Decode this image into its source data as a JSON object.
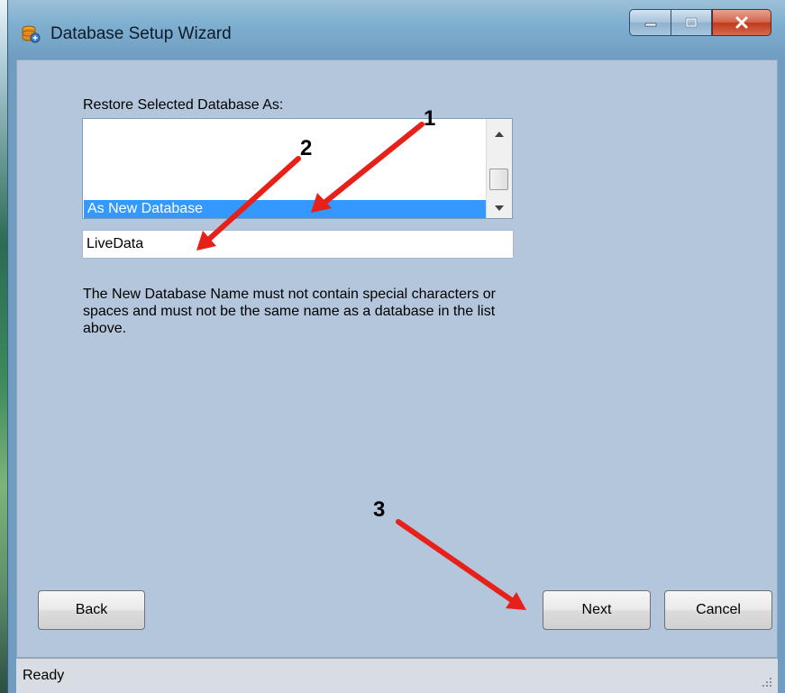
{
  "window": {
    "title": "Database Setup Wizard",
    "icon": "database-wizard-icon"
  },
  "form": {
    "restore_label": "Restore Selected Database As:",
    "list_items": [
      {
        "label": "As New Database",
        "selected": true
      }
    ],
    "name_value": "LiveData",
    "help_text": "The New Database Name must not contain special characters or spaces and must not be the same name as a database in the list above."
  },
  "buttons": {
    "back": "Back",
    "next": "Next",
    "cancel": "Cancel"
  },
  "status": {
    "text": "Ready"
  },
  "annotations": {
    "markers": [
      "1",
      "2",
      "3"
    ],
    "arrow_color": "#e8201a"
  },
  "colors": {
    "client_bg": "#b4c6db",
    "selection": "#3399ff",
    "frame": "#6f9cc0"
  }
}
